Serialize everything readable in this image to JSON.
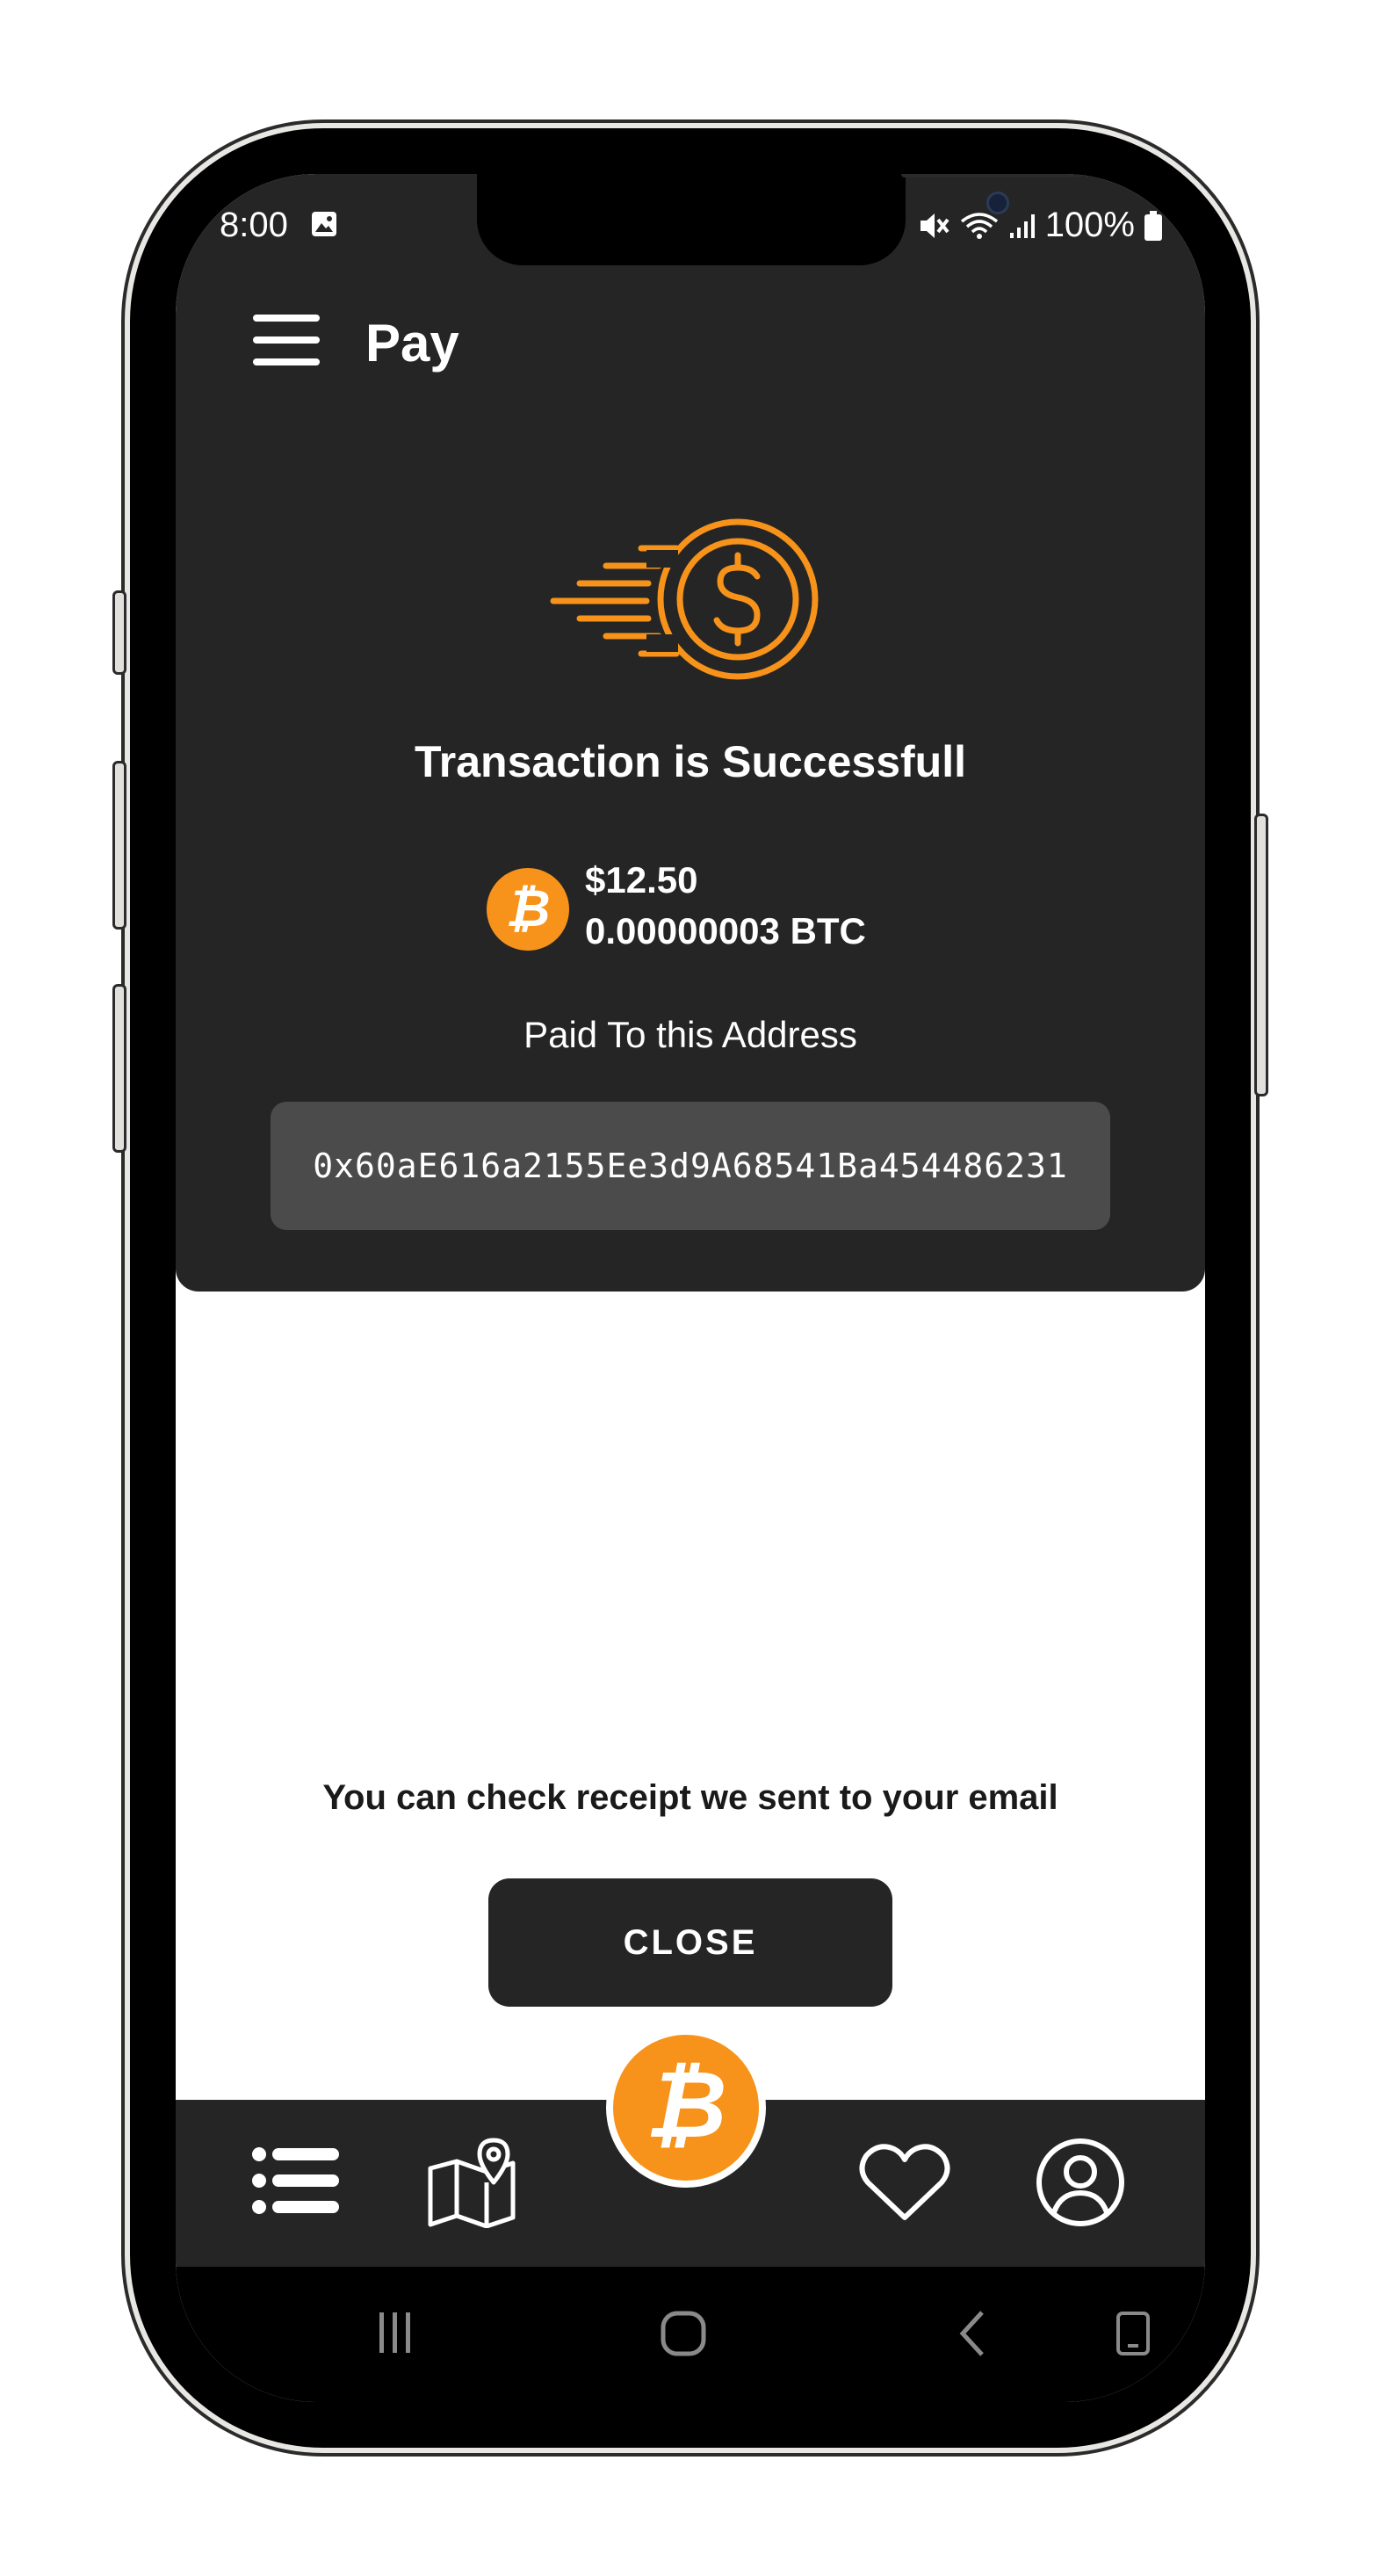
{
  "status_bar": {
    "time": "8:00",
    "battery": "100%"
  },
  "header": {
    "title": "Pay"
  },
  "transaction": {
    "headline": "Transaction is Successfull",
    "amount_usd": "$12.50",
    "amount_btc": "0.00000003 BTC",
    "paid_label": "Paid To this Address",
    "address": "0x60aE616a2155Ee3d9A68541Ba454486231"
  },
  "footer": {
    "receipt_note": "You can check receipt we sent to your email",
    "close_label": "CLOSE"
  },
  "bottom_nav": {
    "items": [
      "list-icon",
      "map-pin-icon",
      "bitcoin-icon",
      "heart-icon",
      "user-icon"
    ]
  },
  "colors": {
    "accent": "#f7931a",
    "panel": "#252525",
    "address_box": "#4b4b4b",
    "background": "#ffffff"
  }
}
